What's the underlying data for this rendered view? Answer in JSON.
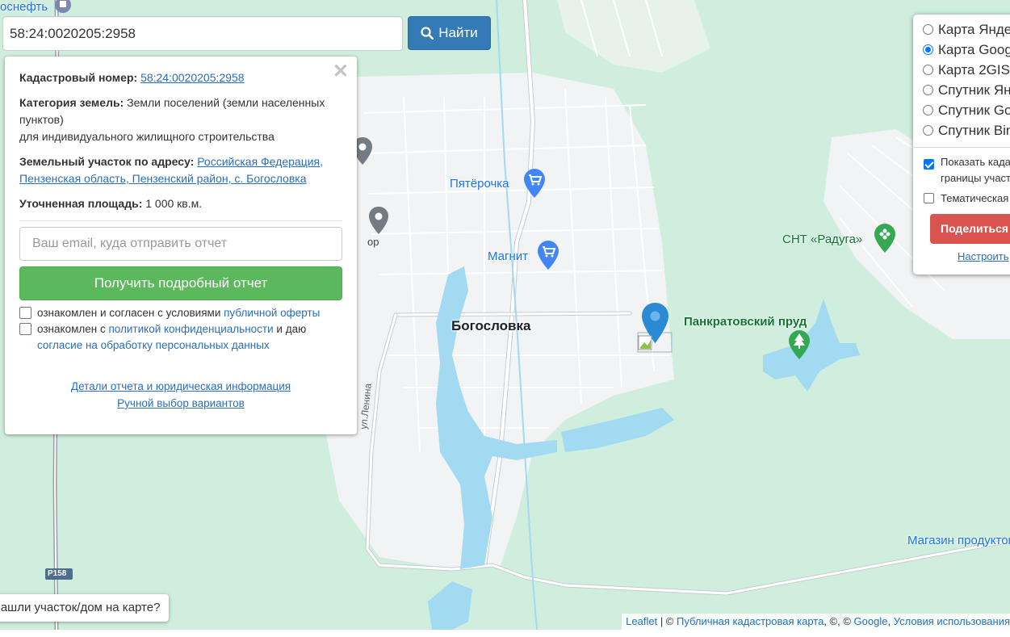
{
  "search": {
    "value": "58:24:0020205:2958",
    "button_label": "Найти"
  },
  "info": {
    "cadastral_label": "Кадастровый номер:",
    "cadastral_value": "58:24:0020205:2958",
    "category_label": "Категория земель:",
    "category_value": "Земли поселений (земли населенных пунктов)",
    "usage": "для индивидуального жилищного строительства",
    "address_label": "Земельный участок по адресу:",
    "address_value": "Российская Федерация, Пензенская область, Пензенский район, с. Богословка",
    "area_label": "Уточненная площадь:",
    "area_value": "1 000 кв.м.",
    "email_placeholder": "Ваш email, куда отправить отчет",
    "get_report_label": "Получить подробный отчет",
    "consent1_text": "ознакомлен и согласен с условиями",
    "consent1_link": "публичной оферты",
    "consent2_text_a": "ознакомлен с",
    "consent2_link_a": "политикой конфиденциальности",
    "consent2_text_b": "и даю",
    "consent2_link_b": "согласие на обработку персональных данных",
    "details_link": "Детали отчета и юридическая информация",
    "manual_link": "Ручной выбор вариантов",
    "close_symbol": "✕"
  },
  "layers": {
    "options": [
      {
        "label": "Карта Яндекс",
        "selected": false
      },
      {
        "label": "Карта Google",
        "selected": true
      },
      {
        "label": "Карта 2GIS",
        "selected": false
      },
      {
        "label": "Спутник Яндекс",
        "selected": false
      },
      {
        "label": "Спутник Google",
        "selected": false
      },
      {
        "label": "Спутник Bing",
        "selected": false
      }
    ],
    "show_borders_label_1": "Показать кадастровые",
    "show_borders_label_2": "границы участков",
    "show_borders_checked": true,
    "thematic_label": "Тематическая карта",
    "thematic_checked": false,
    "share_label": "Поделиться",
    "setup_label": "Настроить"
  },
  "map": {
    "labels": {
      "top_left": "оснефть",
      "pyaterochka": "Пятёрочка",
      "magnit": "Магнит",
      "town": "Богословка",
      "pond": "Панкратовский пруд",
      "snt": "СНТ «Радуга»",
      "shop": "Магазин продуктов",
      "street": "ул.Ленина",
      "road": "Р158",
      "partial_left": "ор"
    },
    "colors": {
      "land": "#cfeedd",
      "settlement": "#f1f3f4",
      "water": "#a1daf1",
      "road": "#ffffff",
      "marker": "#2a8ad4"
    }
  },
  "bottom_prompt": "Нашли участок/дом на карте?",
  "attribution": {
    "leaflet": "Leaflet",
    "sep1": "| ©",
    "pkk": "Публичная кадастровая карта",
    "mid": ", ©, ©",
    "google": "Google",
    "terms": "Условия использования"
  }
}
